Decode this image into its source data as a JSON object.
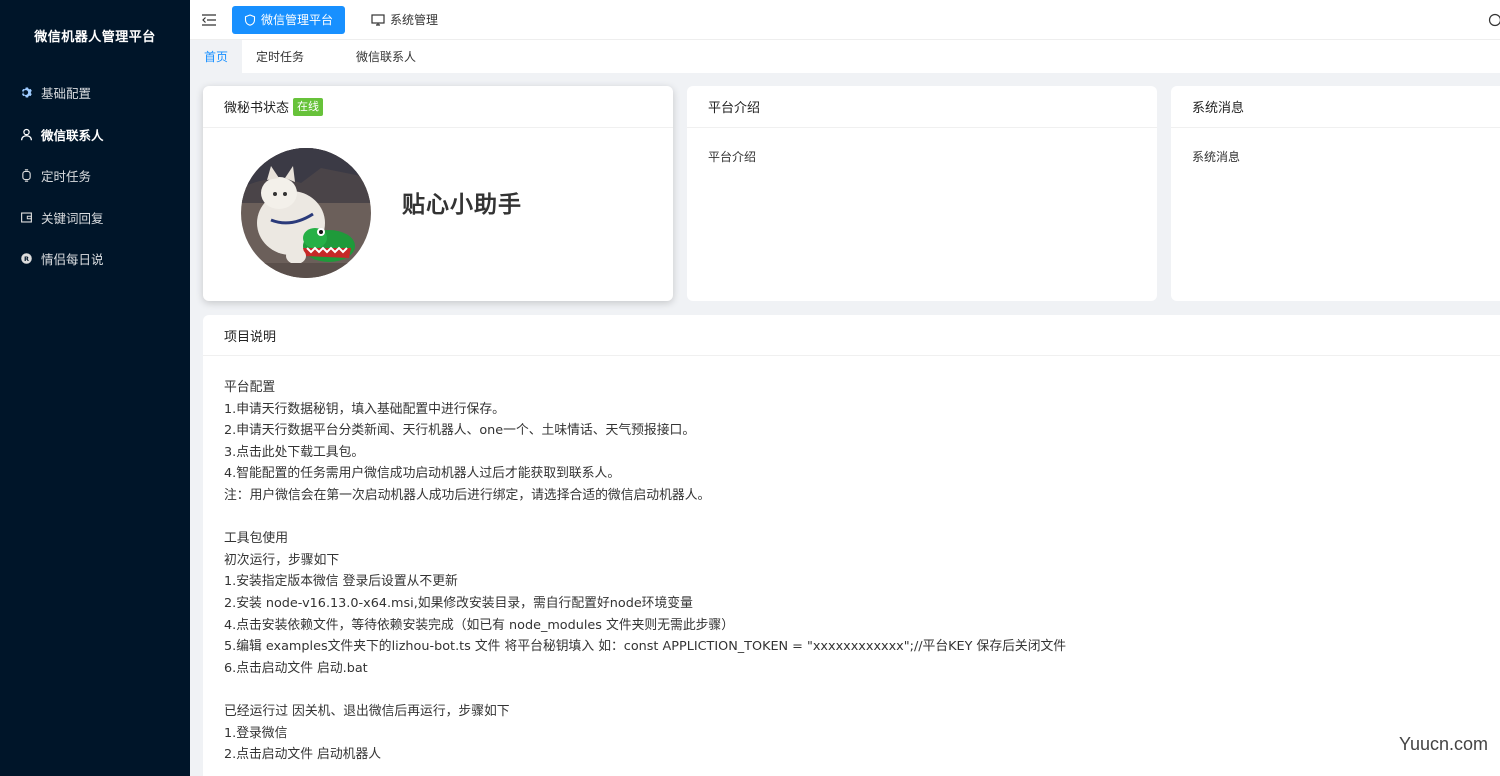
{
  "sidebar": {
    "brand": "微信机器人管理平台",
    "items": [
      {
        "label": "基础配置",
        "icon": "gear-icon"
      },
      {
        "label": "微信联系人",
        "icon": "user-icon"
      },
      {
        "label": "定时任务",
        "icon": "timer-icon"
      },
      {
        "label": "关键词回复",
        "icon": "wallet-icon"
      },
      {
        "label": "情侣每日说",
        "icon": "registered-icon"
      }
    ]
  },
  "header": {
    "nav": [
      {
        "label": "微信管理平台",
        "icon": "shield-icon"
      },
      {
        "label": "系统管理",
        "icon": "monitor-icon"
      }
    ]
  },
  "tabs": [
    {
      "label": "首页"
    },
    {
      "label": "定时任务"
    },
    {
      "label": "微信联系人"
    }
  ],
  "status_card": {
    "title": "微秘书状态",
    "badge": "在线",
    "bot_name": "贴心小助手"
  },
  "intro_card": {
    "title": "平台介绍",
    "body": "平台介绍"
  },
  "msg_card": {
    "title": "系统消息",
    "body": "系统消息"
  },
  "desc_card": {
    "title": "项目说明",
    "sections": [
      {
        "lines": [
          "平台配置",
          "1.申请天行数据秘钥，填入基础配置中进行保存。",
          "2.申请天行数据平台分类新闻、天行机器人、one一个、土味情话、天气预报接口。",
          "3.点击此处下载工具包。",
          "4.智能配置的任务需用户微信成功启动机器人过后才能获取到联系人。",
          "注：用户微信会在第一次启动机器人成功后进行绑定，请选择合适的微信启动机器人。"
        ]
      },
      {
        "lines": [
          "工具包使用",
          "初次运行，步骤如下",
          "1.安装指定版本微信 登录后设置从不更新",
          "2.安装 node-v16.13.0-x64.msi,如果修改安装目录，需自行配置好node环境变量",
          "4.点击安装依赖文件，等待依赖安装完成（如已有 node_modules 文件夹则无需此步骤）",
          "5.编辑 examples文件夹下的lizhou-bot.ts 文件 将平台秘钥填入 如：const APPLICTION_TOKEN = \"xxxxxxxxxxxx\";//平台KEY 保存后关闭文件",
          "6.点击启动文件 启动.bat"
        ]
      },
      {
        "lines": [
          "已经运行过 因关机、退出微信后再运行，步骤如下",
          "1.登录微信",
          "2.点击启动文件 启动机器人"
        ]
      }
    ]
  },
  "watermark": "Yuucn.com",
  "colors": {
    "sidebar_bg": "#001529",
    "primary": "#1890ff",
    "online": "#67c23a"
  }
}
